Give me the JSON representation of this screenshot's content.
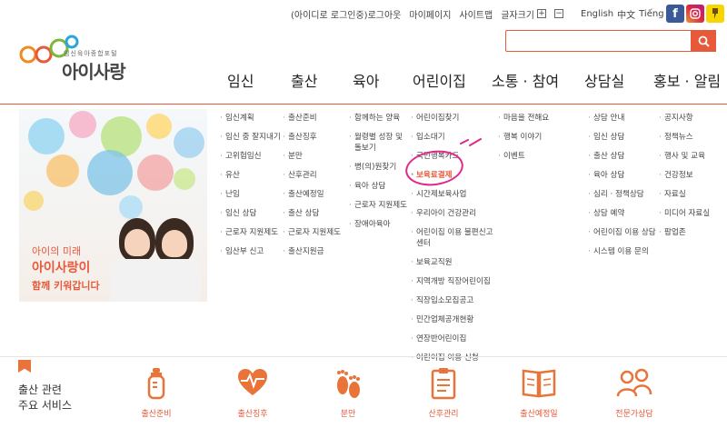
{
  "top_links": {
    "login": "(아이디로 로그인중)로그아웃",
    "mypage": "마이페이지",
    "sitemap": "사이트맵",
    "font_size": "글자크기",
    "plus": "+",
    "minus": "−",
    "lang_en": "English",
    "lang_cn": "中文",
    "lang_vn": "Tiếng Việt"
  },
  "sns": {
    "facebook": "f",
    "facebook_color": "#3b5998",
    "instagram_color": "#c13584",
    "kakao_color": "#f7d600"
  },
  "logo": {
    "subtitle": "임신육아종합포털",
    "name": "아이사랑"
  },
  "search": {
    "placeholder": ""
  },
  "nav": [
    "임신",
    "출산",
    "육아",
    "어린이집",
    "소통 · 참여",
    "상담실",
    "홍보 · 알림"
  ],
  "promo": {
    "line1": "아이의 미래",
    "line2": "아이사랑이",
    "line3": "함께 키워갑니다"
  },
  "menu": {
    "pregnancy": [
      "임신계획",
      "임신 중 잘지내기",
      "고위험임신",
      "유산",
      "난임",
      "임신 상담",
      "근로자 지원제도",
      "임산부 신고"
    ],
    "birth": [
      "출산준비",
      "출산징후",
      "분만",
      "산후관리",
      "출산예정일",
      "출산 상담",
      "근로자 지원제도",
      "출산지원금"
    ],
    "parenting": [
      "함께하는 양육",
      "월령별 성장 및 돌보기",
      "병(의)원찾기",
      "육아 상담",
      "근로자 지원제도",
      "장애아육아"
    ],
    "daycare": [
      "어린이집찾기",
      "입소대기",
      "국민행복카드",
      "보육료결제",
      "시간제보육사업",
      "우리아이 건강관리",
      "어린이집 이용 불편신고센터",
      "보육교직원",
      "지역개방 직장어린이집",
      "직장입소모집공고",
      "민간업체공개현황",
      "연장반어린이집",
      "어린이집 이용 신청"
    ],
    "community": [
      "마음을 전해요",
      "행복 이야기",
      "이벤트"
    ],
    "counsel": [
      "상담 안내",
      "임신 상담",
      "출산 상담",
      "육아 상담",
      "심리 · 정책상담",
      "상담 예약",
      "어린이집 이용 상담",
      "시스템 이용 문의"
    ],
    "news": [
      "공지사항",
      "정책뉴스",
      "행사 및 교육",
      "건강정보",
      "자료실",
      "미디어 자료실",
      "팝업존"
    ]
  },
  "services": {
    "title": "출산 관련\n주요 서비스",
    "items": [
      {
        "label": "출산준비",
        "icon": "bottle-icon"
      },
      {
        "label": "출산징후",
        "icon": "heartbeat-icon"
      },
      {
        "label": "분만",
        "icon": "footprints-icon"
      },
      {
        "label": "산후관리",
        "icon": "clipboard-icon"
      },
      {
        "label": "출산예정일",
        "icon": "book-icon"
      },
      {
        "label": "전문가상담",
        "icon": "counselors-icon"
      }
    ],
    "accent": "#e8593a"
  }
}
